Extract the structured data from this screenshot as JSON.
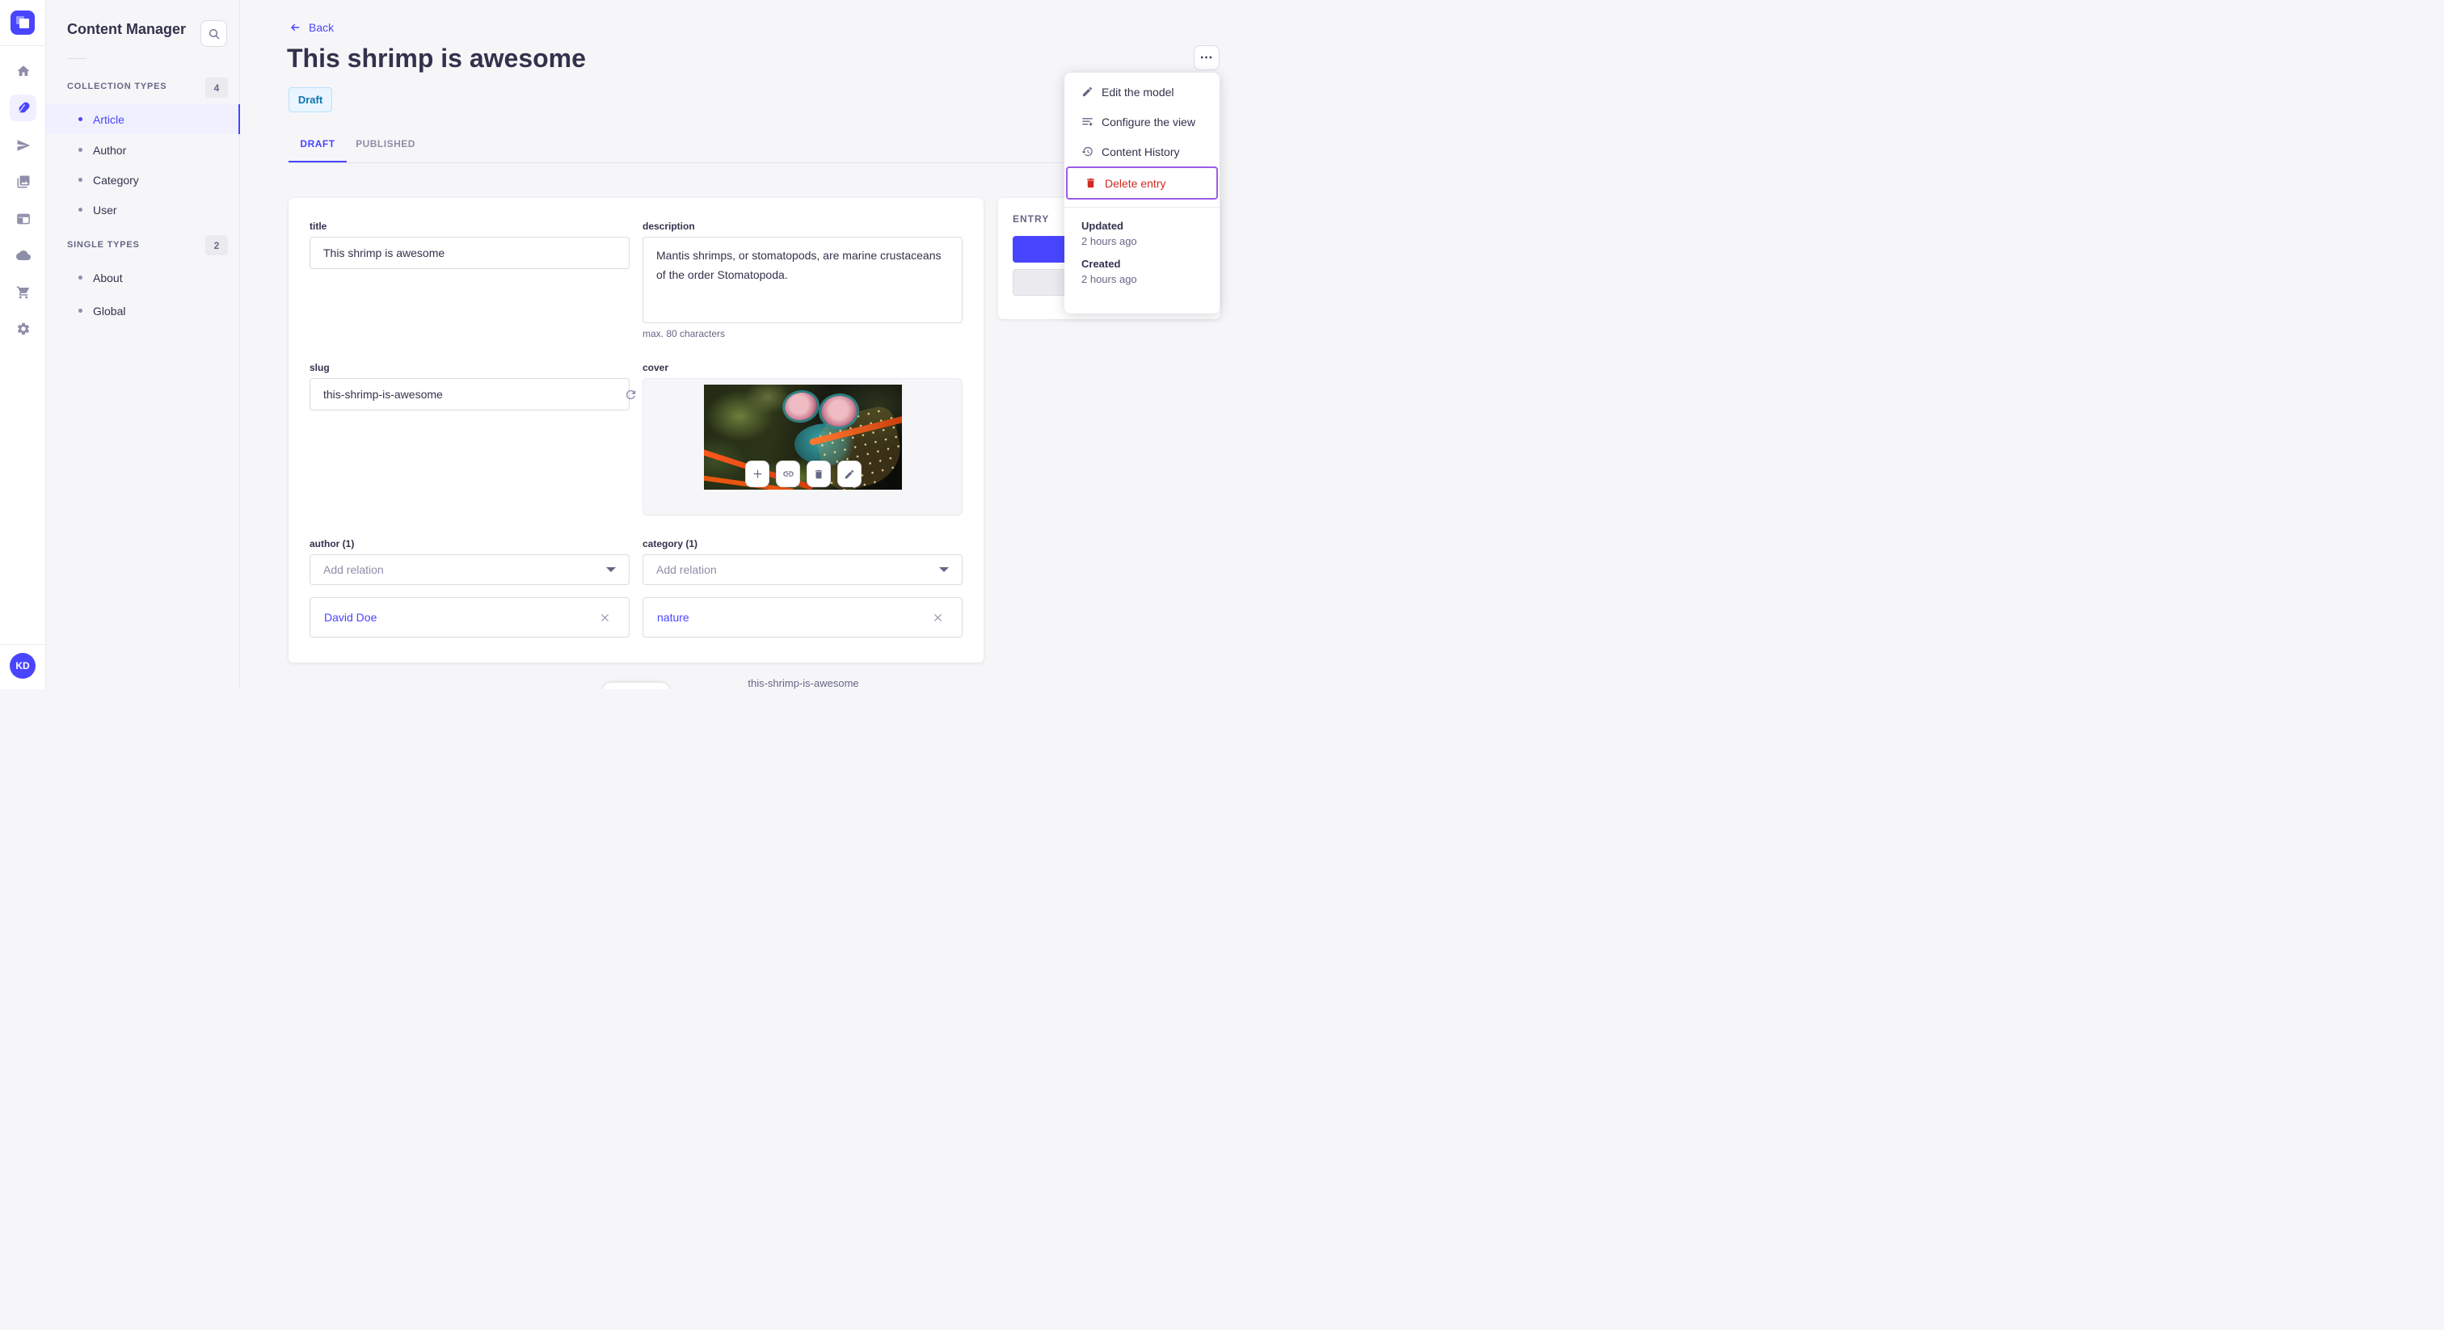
{
  "rail": {
    "icons": [
      "home",
      "feather",
      "paper-plane",
      "media-gallery",
      "layout-panel",
      "cloud",
      "shopping-cart",
      "gear"
    ],
    "active_icon": "feather",
    "avatar_initials": "KD"
  },
  "sidebar": {
    "title": "Content Manager",
    "search_icon": "magnifier",
    "sections": [
      {
        "label": "COLLECTION TYPES",
        "count": "4",
        "items": [
          {
            "label": "Article"
          },
          {
            "label": "Author"
          },
          {
            "label": "Category"
          },
          {
            "label": "User"
          }
        ],
        "active_item": "Article"
      },
      {
        "label": "SINGLE TYPES",
        "count": "2",
        "items": [
          {
            "label": "About"
          },
          {
            "label": "Global"
          }
        ]
      }
    ]
  },
  "header": {
    "back_label": "Back",
    "title": "This shrimp is awesome",
    "status_badge": "Draft",
    "more_label": "⋯",
    "tabs": [
      {
        "label": "DRAFT"
      },
      {
        "label": "PUBLISHED"
      }
    ],
    "active_tab": "DRAFT"
  },
  "context_menu": {
    "items": [
      {
        "label": "Edit the model",
        "icon": "pencil"
      },
      {
        "label": "Configure the view",
        "icon": "list-settings"
      },
      {
        "label": "Content History",
        "icon": "history"
      },
      {
        "label": "Delete entry",
        "icon": "trash",
        "danger": true,
        "focused": true
      }
    ],
    "meta": [
      {
        "label": "Updated",
        "value": "2 hours ago"
      },
      {
        "label": "Created",
        "value": "2 hours ago"
      }
    ]
  },
  "entry_panel": {
    "title": "ENTRY"
  },
  "form": {
    "title": {
      "label": "title",
      "value": "This shrimp is awesome"
    },
    "description": {
      "label": "description",
      "value": "Mantis shrimps, or stomatopods, are marine crustaceans of the order Stomatopoda.",
      "hint": "max. 80 characters"
    },
    "slug": {
      "label": "slug",
      "value": "this-shrimp-is-awesome",
      "action_icon": "refresh"
    },
    "cover": {
      "label": "cover",
      "caption": "this-shrimp-is-awesome",
      "action_icons": [
        "plus",
        "link",
        "trash",
        "pencil"
      ]
    },
    "author": {
      "label": "author (1)",
      "placeholder": "Add relation",
      "relation": "David Doe"
    },
    "category": {
      "label": "category (1)",
      "placeholder": "Add relation",
      "relation": "nature"
    }
  },
  "colors": {
    "primary": "#4945ff",
    "danger": "#d02b20",
    "focus_ring": "#9b5ce6",
    "draft_bg": "#eaf5ff",
    "draft_border": "#b8e1ff",
    "draft_text": "#0c75af",
    "page_bg": "#f6f6f9"
  }
}
